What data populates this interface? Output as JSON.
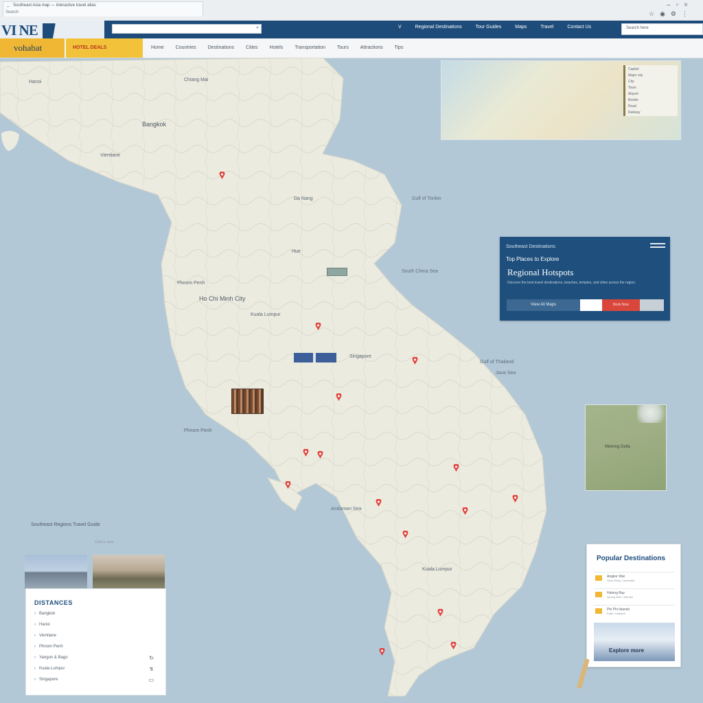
{
  "browser": {
    "tab_title": "Southeast Asia map — interactive travel atlas",
    "address": "Search",
    "icons": [
      "star-icon",
      "account-icon",
      "extensions-icon",
      "menu-icon"
    ]
  },
  "nav": {
    "logo_text": "VI NE",
    "search_placeholder": "",
    "search_icon": "search-icon",
    "links": [
      "V",
      "Regional Destinations",
      "Tour Guides",
      "Maps",
      "Travel",
      "Contact Us"
    ],
    "right_search_placeholder": "Search here"
  },
  "subbar": {
    "brand": "vohabat",
    "promo": "HOTEL DEALS",
    "links": [
      "Home",
      "Countries",
      "Destinations",
      "Cities",
      "Hotels",
      "Transportation",
      "Tours",
      "Attractions",
      "Tips"
    ]
  },
  "map": {
    "places": [
      {
        "label": "Hanoi"
      },
      {
        "label": "Chiang Mai"
      },
      {
        "label": "Gulf of Tonkin"
      },
      {
        "label": "Bangkok"
      },
      {
        "label": "Vientiane"
      },
      {
        "label": "South China Sea"
      },
      {
        "label": "Da Nang"
      },
      {
        "label": "Hue"
      },
      {
        "label": "Gulf of Thailand"
      },
      {
        "label": "Phnom Penh"
      },
      {
        "label": "Ho Chi Minh City"
      },
      {
        "label": "Andaman Sea"
      },
      {
        "label": "Kuala Lumpur"
      },
      {
        "label": "Singapore"
      }
    ],
    "seas": [
      {
        "label": "Gulf of Tonkin"
      },
      {
        "label": "South China Sea"
      },
      {
        "label": "Gulf of Thailand"
      },
      {
        "label": "Andaman Sea"
      },
      {
        "label": "Java Sea"
      }
    ],
    "pin_color": "#e0453d",
    "land_color": "#ecebe0",
    "water_color": "#b3c8d7"
  },
  "inset_top": {
    "legend_items": [
      "Capital",
      "Major city",
      "City",
      "Town",
      "Airport",
      "Border",
      "Road",
      "Railway"
    ]
  },
  "info_card": {
    "title": "Southeast Destinations",
    "subtitle": "Top Places to Explore",
    "headline": "Regional Hotspots",
    "description": "Discover the best travel destinations, beaches, temples, and cities across the region.",
    "button_primary": "View All Maps",
    "button_accent": "Book Now"
  },
  "terrain_panel": {
    "label": "Mekong Delta"
  },
  "side_card": {
    "title": "Popular Destinations",
    "items": [
      {
        "title": "Angkor Wat",
        "meta": "Siem Reap, Cambodia"
      },
      {
        "title": "Halong Bay",
        "meta": "Quang Ninh, Vietnam"
      },
      {
        "title": "Phi Phi Islands",
        "meta": "Krabi, Thailand"
      }
    ],
    "photo_caption": "Explore more"
  },
  "legend_panel": {
    "header": "Southeast Regions Travel Guide",
    "subheader": "Click to view",
    "title": "DISTANCES",
    "rows": [
      {
        "label": "Bangkok",
        "icon": ""
      },
      {
        "label": "Hanoi",
        "icon": ""
      },
      {
        "label": "Vientiane",
        "icon": ""
      },
      {
        "label": "Phnom Penh",
        "icon": ""
      },
      {
        "label": "Yangon & Bago",
        "icon": "↻"
      },
      {
        "label": "Kuala Lumpur",
        "icon": "↯"
      },
      {
        "label": "Singapore",
        "icon": "▭"
      }
    ]
  }
}
